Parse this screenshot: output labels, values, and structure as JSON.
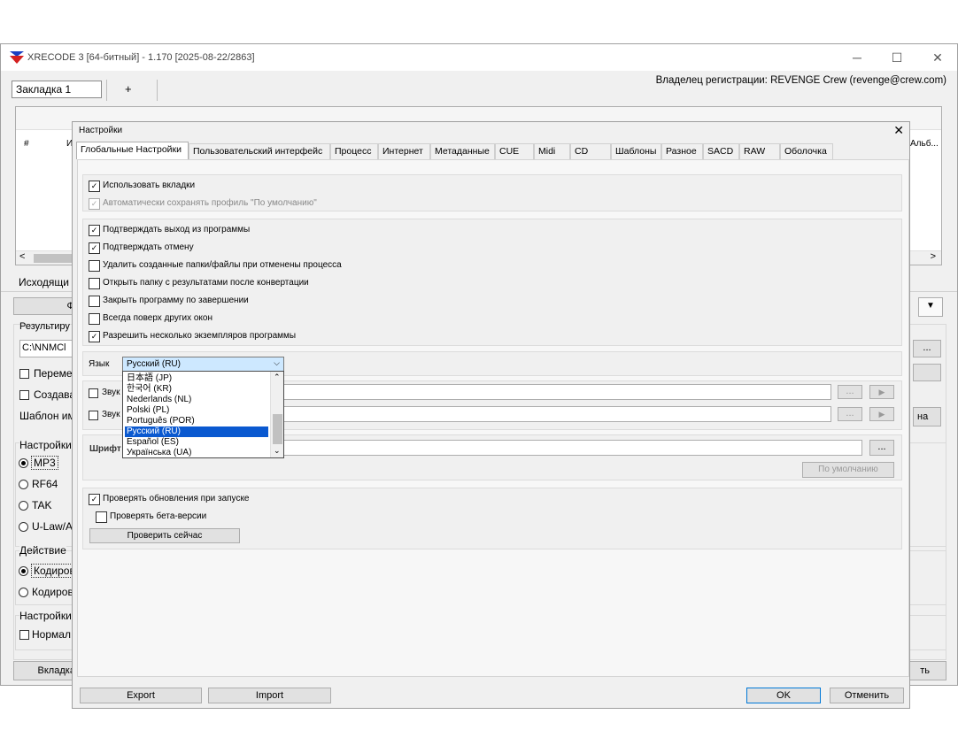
{
  "window": {
    "title": "XRECODE 3 [64-битный] - 1.170 [2025-08-22/2863]",
    "minimize": "─",
    "maximize": "☐",
    "close": "✕",
    "owner": "Владелец регистрации: REVENGE Crew (revenge@crew.com)"
  },
  "tabs": {
    "current": "Закладка 1",
    "add": "+"
  },
  "list": {
    "col_num": "#",
    "col_i": "И",
    "col_album": "Альб...",
    "scroll_left": "<",
    "scroll_right": ">"
  },
  "main": {
    "source_label": "Исходящи",
    "files_btn": "Фа",
    "result_label": "Результиру",
    "output_path": "C:\\NNMCl",
    "move_label": "Переме",
    "create_label": "Создава",
    "template_label": "Шаблон им",
    "settings_label": "Настройки",
    "formats": [
      "MP3",
      "RF64",
      "TAK",
      "U-Law/A"
    ],
    "action_label": "Действие",
    "actions": [
      "Кодиров",
      "Кодиров"
    ],
    "settings2_label": "Настройки",
    "normalize_label": "Нормал",
    "bottom_btn": "Вкладка/",
    "right_dots": "...",
    "right_na": "на",
    "right_bottom": "ть"
  },
  "dialog": {
    "title": "Настройки",
    "close": "✕",
    "tabs": [
      "Глобальные Настройки",
      "Пользовательский интерфейс",
      "Процесс",
      "Интернет",
      "Метаданные",
      "CUE",
      "Midi",
      "CD",
      "Шаблоны",
      "Разное",
      "SACD",
      "RAW",
      "Оболочка"
    ],
    "use_tabs": "Использовать вкладки",
    "autosave": "Автоматически сохранять профиль \"По умолчанию\"",
    "options": [
      "Подтверждать выход из программы",
      "Подтверждать отмену",
      "Удалить созданные папки/файлы при отменены процесса",
      "Открыть папку с результатами после конвертации",
      "Закрыть программу по завершении",
      "Всегда поверх других окон",
      "Разрешить несколько экземпляров программы"
    ],
    "language_label": "Язык",
    "language_value": "Русский (RU)",
    "languages": [
      "日本語 (JP)",
      "한국어 (KR)",
      "Nederlands (NL)",
      "Polski (PL)",
      "Português (POR)",
      "Русский (RU)",
      "Español (ES)",
      "Українська (UA)"
    ],
    "sound1_label": "Звук",
    "sound2_label": "Звук",
    "font_label": "Шрифт",
    "dots": "...",
    "play": "▶",
    "default_btn": "По умолчанию",
    "check_updates": "Проверять обновления при запуске",
    "check_beta": "Проверять бета-версии",
    "check_now": "Проверить сейчас",
    "export": "Export",
    "import": "Import",
    "ok": "OK",
    "cancel": "Отменить"
  }
}
